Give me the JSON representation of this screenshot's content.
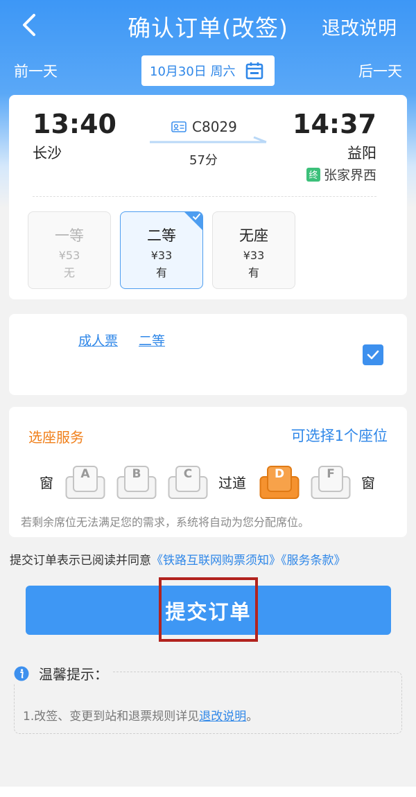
{
  "header": {
    "title": "确认订单(改签)",
    "right_link": "退改说明"
  },
  "date_bar": {
    "prev": "前一天",
    "date": "10月30日 周六",
    "next": "后一天"
  },
  "train": {
    "departure_time": "13:40",
    "departure_station": "长沙",
    "arrival_time": "14:37",
    "arrival_station": "益阳",
    "train_number": "C8029",
    "duration": "57分",
    "terminal_badge": "终",
    "terminal_station": "张家界西"
  },
  "seat_classes": [
    {
      "name": "一等",
      "price": "¥53",
      "availability": "无",
      "state": "disabled"
    },
    {
      "name": "二等",
      "price": "¥33",
      "availability": "有",
      "state": "selected"
    },
    {
      "name": "无座",
      "price": "¥33",
      "availability": "有",
      "state": "normal"
    }
  ],
  "passenger": {
    "ticket_type": "成人票",
    "seat_class": "二等",
    "checked": true
  },
  "seat_service": {
    "title": "选座服务",
    "hint": "可选择1个座位",
    "window_label": "窗",
    "aisle_label": "过道",
    "seats": [
      {
        "letter": "A",
        "selected": false
      },
      {
        "letter": "B",
        "selected": false
      },
      {
        "letter": "C",
        "selected": false
      },
      {
        "letter": "D",
        "selected": true
      },
      {
        "letter": "F",
        "selected": false
      }
    ],
    "note": "若剩余席位无法满足您的需求，系统将自动为您分配席位。"
  },
  "agreement": {
    "prefix": "提交订单表示已阅读并同意",
    "link1": "《铁路互联网购票须知》",
    "link2": "《服务条款》"
  },
  "submit_label": "提交订单",
  "tips": {
    "title": "温馨提示：",
    "line_prefix": "1.改签、变更到站和退票规则详见",
    "line_link": "退改说明",
    "line_suffix": "。"
  },
  "colors": {
    "accent_blue": "#3e97f4",
    "orange": "#f07f1a",
    "highlight_red": "#b2231e"
  }
}
